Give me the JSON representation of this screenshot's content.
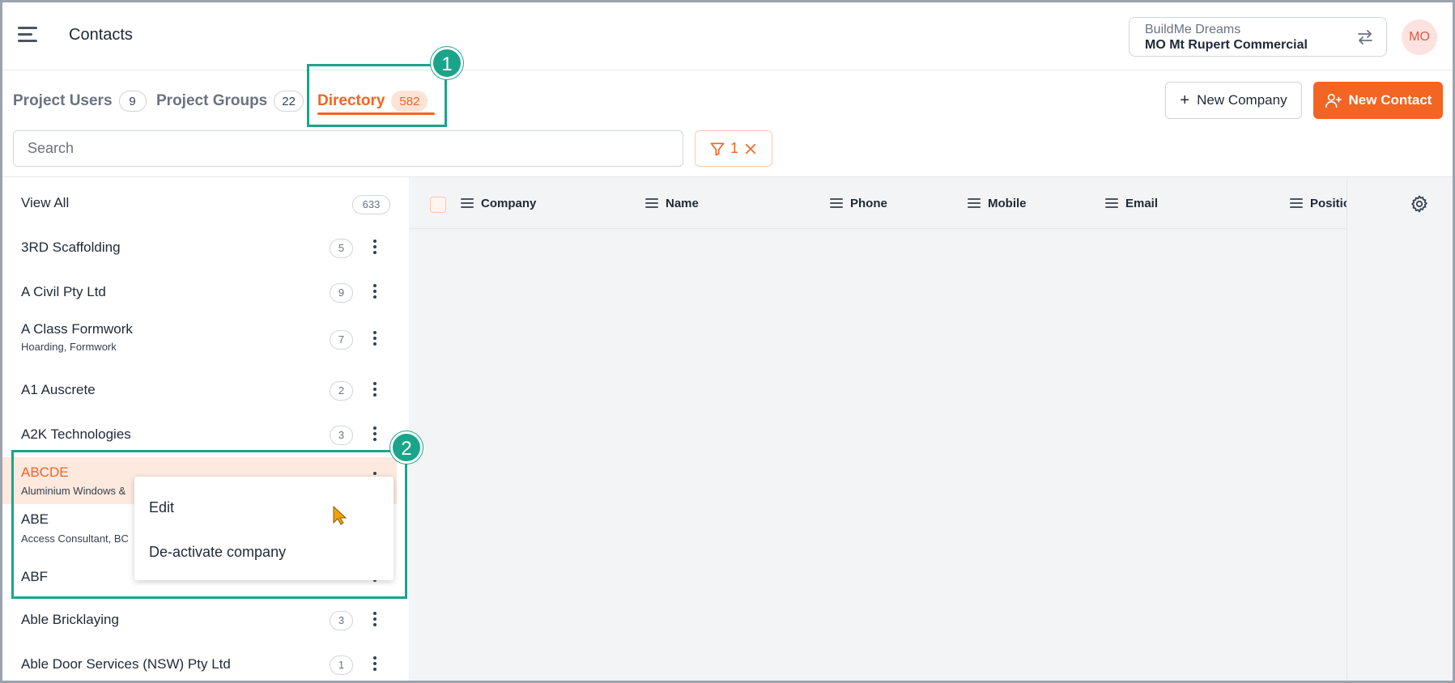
{
  "header": {
    "title": "Contacts",
    "menu_icon": "hamburger-icon",
    "project": {
      "org": "BuildMe Dreams",
      "name": "MO Mt Rupert Commercial",
      "switch_icon": "swap-arrows-icon"
    },
    "avatar_initials": "MO"
  },
  "tabs": [
    {
      "label": "Project Users",
      "count": "9"
    },
    {
      "label": "Project Groups",
      "count": "22"
    },
    {
      "label": "Directory",
      "count": "582",
      "active": true
    }
  ],
  "actions": {
    "new_company": "New Company",
    "new_contact": "New Contact"
  },
  "search": {
    "placeholder": "Search",
    "value": ""
  },
  "filter": {
    "count": "1",
    "icon": "funnel-icon",
    "clear_icon": "close-icon"
  },
  "grid": {
    "columns": [
      "Company",
      "Name",
      "Phone",
      "Mobile",
      "Email",
      "Positio"
    ],
    "settings_icon": "gear-icon"
  },
  "sidebar": {
    "view_all": {
      "label": "View All",
      "count": "633"
    },
    "companies": [
      {
        "name": "3RD Scaffolding",
        "count": "5",
        "sub": ""
      },
      {
        "name": "A Civil Pty Ltd",
        "count": "9",
        "sub": ""
      },
      {
        "name": "A Class Formwork",
        "count": "7",
        "sub": "Hoarding, Formwork"
      },
      {
        "name": "A1 Auscrete",
        "count": "2",
        "sub": ""
      },
      {
        "name": "A2K Technologies",
        "count": "3",
        "sub": ""
      },
      {
        "name": "ABCDE",
        "count": "",
        "sub": "Aluminium Windows &",
        "selected": true
      },
      {
        "name": "ABE",
        "count": "",
        "sub": "Access Consultant, BC"
      },
      {
        "name": "ABF",
        "count": "",
        "sub": ""
      },
      {
        "name": "Able Bricklaying",
        "count": "3",
        "sub": ""
      },
      {
        "name": "Able Door Services (NSW) Pty Ltd",
        "count": "1",
        "sub": ""
      }
    ]
  },
  "context_menu": {
    "items": [
      "Edit",
      "De-activate company"
    ]
  },
  "annotations": [
    "1",
    "2"
  ],
  "colors": {
    "accent": "#f26522",
    "annotation": "#1aa58a",
    "avatar_bg": "#fde2df"
  }
}
